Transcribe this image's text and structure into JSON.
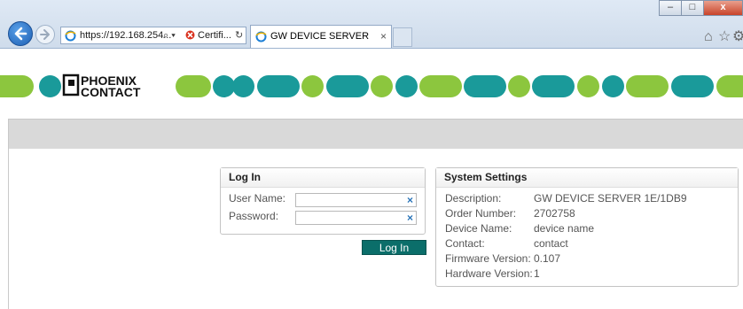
{
  "browser": {
    "address_url": "https://192.168.254...",
    "address_search_glyph": "⌕ ▾",
    "certificate_label": "Certifi...",
    "refresh_glyph": "↻",
    "tab_title": "GW DEVICE SERVER",
    "tab_close": "×",
    "window_minimize": "–",
    "window_maximize": "□",
    "window_close": "x",
    "home_icon": "⌂",
    "favorites_icon": "☆",
    "tools_icon": "⚙"
  },
  "brand": {
    "logo_line1": "PHOENIX",
    "logo_line2": "CONTACT",
    "green": "#8cc63e",
    "teal": "#1a9a9a"
  },
  "login": {
    "title": "Log In",
    "username_label": "User Name:",
    "password_label": "Password:",
    "username_value": "",
    "password_value": "",
    "clear_icon": "×",
    "button_label": "Log In"
  },
  "system": {
    "title": "System Settings",
    "rows": [
      {
        "label": "Description:",
        "value": "GW DEVICE SERVER 1E/1DB9"
      },
      {
        "label": "Order Number:",
        "value": "2702758"
      },
      {
        "label": "Device Name:",
        "value": "device name"
      },
      {
        "label": "Contact:",
        "value": "contact"
      },
      {
        "label": "Firmware Version:",
        "value": "0.107"
      },
      {
        "label": "Hardware Version:",
        "value": "1"
      }
    ]
  }
}
